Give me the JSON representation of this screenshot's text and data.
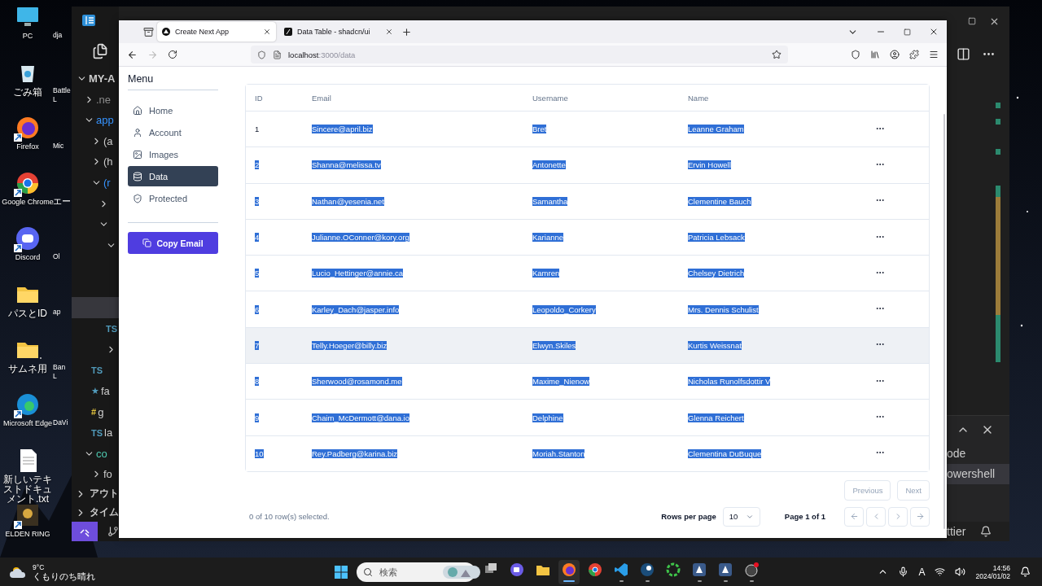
{
  "desktop": {
    "icons": [
      {
        "label": "PC",
        "kind": "pc",
        "shortcut": false
      },
      {
        "label": "ごみ箱",
        "kind": "trash",
        "shortcut": false
      },
      {
        "label": "Firefox",
        "kind": "firefox",
        "shortcut": true
      },
      {
        "label": "Google Chrome",
        "kind": "chrome",
        "shortcut": true
      },
      {
        "label": "Discord",
        "kind": "discord",
        "shortcut": true
      },
      {
        "label": "パスとID",
        "kind": "folder",
        "shortcut": false
      },
      {
        "label": "サムネ用",
        "kind": "folder",
        "shortcut": false
      },
      {
        "label": "Microsoft Edge",
        "kind": "edge",
        "shortcut": true
      },
      {
        "label": "新しいテキストドキュメント.txt",
        "kind": "text",
        "shortcut": false
      },
      {
        "label": "ELDEN RING",
        "kind": "game",
        "shortcut": true
      }
    ],
    "second_column": [
      {
        "lines": [
          "dja"
        ]
      },
      {
        "lines": [
          "Battle",
          "L"
        ]
      },
      {
        "lines": [
          "Mic"
        ]
      },
      {
        "lines": [
          "エー"
        ]
      },
      {
        "lines": [
          "Ol"
        ]
      },
      {
        "lines": [
          "ap"
        ]
      },
      {
        "lines": [
          "Ban",
          "L"
        ]
      },
      {
        "lines": [
          "DaVi"
        ]
      }
    ]
  },
  "editor": {
    "explorer": [
      {
        "label": "MY-A",
        "kind": "folder",
        "expanded": true,
        "color": "#cccccc",
        "children": [
          {
            "label": ".ne",
            "kind": "folder",
            "expanded": false,
            "color": "#8b8b8b"
          },
          {
            "label": "app",
            "kind": "folder",
            "expanded": true,
            "color": "#3794ff",
            "children": [
              {
                "label": "(a",
                "kind": "folder",
                "expanded": false,
                "color": "#cccccc"
              },
              {
                "label": "(h",
                "kind": "folder",
                "expanded": false,
                "color": "#cccccc"
              },
              {
                "label": "(r",
                "kind": "folder",
                "expanded": true,
                "color": "#3794ff",
                "children": [
                  {
                    "kind": "folder",
                    "expanded": false
                  },
                  {
                    "kind": "folder",
                    "expanded": true,
                    "children": [
                      {
                        "kind": "folder",
                        "expanded": true,
                        "children": [
                          {
                            "kind": "file",
                            "selected": false
                          },
                          {
                            "kind": "file",
                            "selected": false
                          },
                          {
                            "kind": "file",
                            "selected": true
                          }
                        ]
                      },
                      {
                        "kind": "file",
                        "badge": "TS",
                        "selected": false
                      },
                      {
                        "kind": "folder",
                        "expanded": false
                      }
                    ]
                  }
                ]
              },
              {
                "kind": "file",
                "badge": "TS",
                "selected": false
              },
              {
                "label": "fa",
                "kind": "file",
                "badge": "★",
                "selected": false,
                "color": "#cccccc"
              },
              {
                "label": "g",
                "kind": "file",
                "badge": "#",
                "selected": false,
                "color": "#cccccc"
              },
              {
                "label": "la",
                "kind": "file",
                "badge": "TS",
                "selected": false,
                "color": "#cccccc"
              }
            ]
          },
          {
            "label": "co",
            "kind": "folder",
            "expanded": true,
            "color": "#4ec9b0",
            "children": [
              {
                "label": "fo",
                "kind": "folder",
                "expanded": false,
                "color": "#cccccc"
              }
            ]
          }
        ]
      }
    ],
    "sections": [
      {
        "label": "アウト",
        "expanded": false
      },
      {
        "label": "タイム",
        "expanded": false
      }
    ],
    "panel": {
      "lines": [
        {
          "text": "ode",
          "selected": false
        },
        {
          "text": "owershell",
          "selected": true
        }
      ]
    },
    "status_text": "ttier"
  },
  "browser": {
    "tabs": [
      {
        "title": "Create Next App",
        "selected": true
      },
      {
        "title": "Data Table - shadcn/ui",
        "selected": false
      }
    ],
    "url": {
      "host": "localhost",
      "rest": ":3000/data"
    },
    "sidebar": {
      "title": "Menu",
      "items": [
        {
          "label": "Home",
          "selected": false
        },
        {
          "label": "Account",
          "selected": false
        },
        {
          "label": "Images",
          "selected": false
        },
        {
          "label": "Data",
          "selected": true
        },
        {
          "label": "Protected",
          "selected": false
        }
      ],
      "button": "Copy Email"
    },
    "table": {
      "columns": [
        "ID",
        "Email",
        "Username",
        "Name"
      ],
      "text_highlighted": true,
      "rows": [
        {
          "id": "1",
          "email": "Sincere@april.biz",
          "username": "Bret",
          "name": "Leanne Graham",
          "id_highlighted": false,
          "hovered": false
        },
        {
          "id": "2",
          "email": "Shanna@melissa.tv",
          "username": "Antonette",
          "name": "Ervin Howell",
          "id_highlighted": true,
          "hovered": false
        },
        {
          "id": "3",
          "email": "Nathan@yesenia.net",
          "username": "Samantha",
          "name": "Clementine Bauch",
          "id_highlighted": true,
          "hovered": false
        },
        {
          "id": "4",
          "email": "Julianne.OConner@kory.org",
          "username": "Karianne",
          "name": "Patricia Lebsack",
          "id_highlighted": true,
          "hovered": false
        },
        {
          "id": "5",
          "email": "Lucio_Hettinger@annie.ca",
          "username": "Kamren",
          "name": "Chelsey Dietrich",
          "id_highlighted": true,
          "hovered": false
        },
        {
          "id": "6",
          "email": "Karley_Dach@jasper.info",
          "username": "Leopoldo_Corkery",
          "name": "Mrs. Dennis Schulist",
          "id_highlighted": true,
          "hovered": false
        },
        {
          "id": "7",
          "email": "Telly.Hoeger@billy.biz",
          "username": "Elwyn.Skiles",
          "name": "Kurtis Weissnat",
          "id_highlighted": true,
          "hovered": true
        },
        {
          "id": "8",
          "email": "Sherwood@rosamond.me",
          "username": "Maxime_Nienow",
          "name": "Nicholas Runolfsdottir V",
          "id_highlighted": true,
          "hovered": false
        },
        {
          "id": "9",
          "email": "Chaim_McDermott@dana.io",
          "username": "Delphine",
          "name": "Glenna Reichert",
          "id_highlighted": true,
          "hovered": false
        },
        {
          "id": "10",
          "email": "Rey.Padberg@karina.biz",
          "username": "Moriah.Stanton",
          "name": "Clementina DuBuque",
          "id_highlighted": true,
          "hovered": false
        }
      ]
    },
    "pager": {
      "previous": "Previous",
      "next": "Next",
      "selection": "0 of 10 row(s) selected.",
      "rows_label": "Rows per page",
      "rows_value": "10",
      "page": "Page 1 of 1"
    }
  },
  "taskbar": {
    "weather": {
      "temp": "9°C",
      "text": "くもりのち晴れ"
    },
    "search": {
      "placeholder": "検索"
    },
    "apps": [
      {
        "kind": "taskview",
        "running": false,
        "active": false
      },
      {
        "kind": "meet",
        "running": false,
        "active": false
      },
      {
        "kind": "files",
        "running": false,
        "active": false
      },
      {
        "kind": "firefox",
        "running": true,
        "active": true
      },
      {
        "kind": "chrome",
        "running": false,
        "active": false
      },
      {
        "kind": "vscode",
        "running": true,
        "active": false
      },
      {
        "kind": "steam",
        "running": true,
        "active": false
      },
      {
        "kind": "ring",
        "running": false,
        "active": false
      },
      {
        "kind": "app",
        "running": true,
        "active": false
      },
      {
        "kind": "app",
        "running": true,
        "active": false
      },
      {
        "kind": "alert",
        "running": true,
        "active": false
      }
    ],
    "ime": "A",
    "time": "14:56",
    "date": "2024/01/02"
  }
}
